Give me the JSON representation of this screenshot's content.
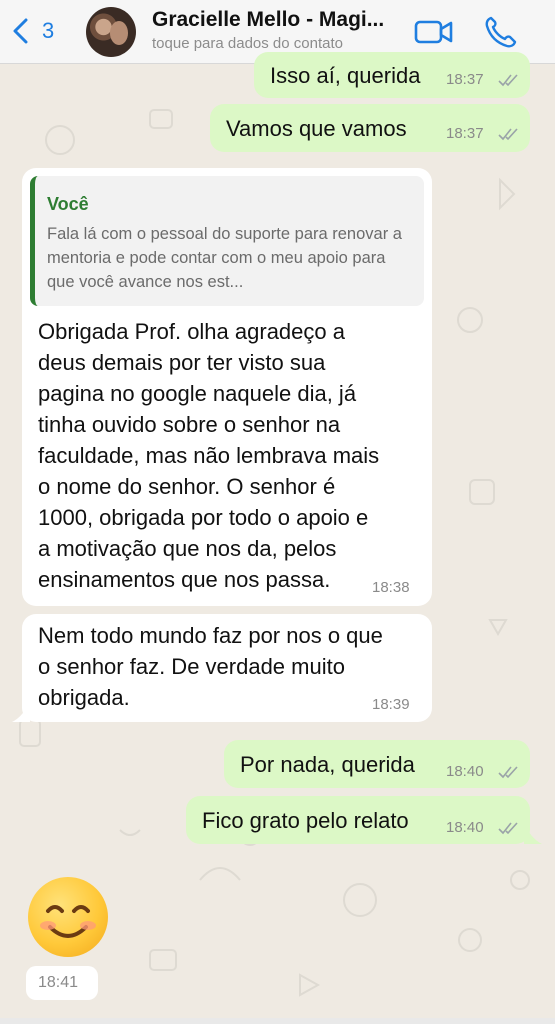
{
  "colors": {
    "accent_blue": "#1f7ee0",
    "outgoing_bubble": "#dcf8c6",
    "incoming_bubble": "#ffffff",
    "quote_bar": "#2e7d32",
    "chat_background": "#efeae2"
  },
  "header": {
    "back_count": "3",
    "contact_name": "Gracielle Mello - Magi...",
    "contact_subtitle": "toque para dados do contato",
    "icons": [
      "chevron-left-icon",
      "video-call-icon",
      "phone-icon"
    ]
  },
  "messages": [
    {
      "direction": "outgoing",
      "text": "Isso aí, querida",
      "time": "18:37",
      "status": "read"
    },
    {
      "direction": "outgoing",
      "text": "Vamos que vamos",
      "time": "18:37",
      "status": "read"
    },
    {
      "direction": "incoming",
      "quote": {
        "author": "Você",
        "text": "Fala lá com o pessoal do suporte para renovar a mentoria e pode contar com o meu apoio para que você avance nos est..."
      },
      "text_lines": [
        "Obrigada Prof. olha agradeço a",
        "deus demais por ter visto sua",
        "pagina no google naquele dia, já",
        "tinha ouvido sobre o senhor na",
        "faculdade, mas não lembrava mais",
        "o nome do senhor. O senhor é",
        "1000, obrigada por todo o apoio e",
        "a motivação que nos da, pelos",
        "ensinamentos que nos passa."
      ],
      "time": "18:38"
    },
    {
      "direction": "incoming",
      "text_lines": [
        "Nem todo mundo faz por nos o que",
        "o senhor faz. De verdade muito",
        "obrigada."
      ],
      "time": "18:39"
    },
    {
      "direction": "outgoing",
      "text": "Por nada, querida",
      "time": "18:40",
      "status": "read"
    },
    {
      "direction": "outgoing",
      "text": "Fico grato pelo relato",
      "time": "18:40",
      "status": "read"
    },
    {
      "direction": "incoming",
      "emoji": "smiling-face-icon",
      "time": "18:41"
    }
  ]
}
